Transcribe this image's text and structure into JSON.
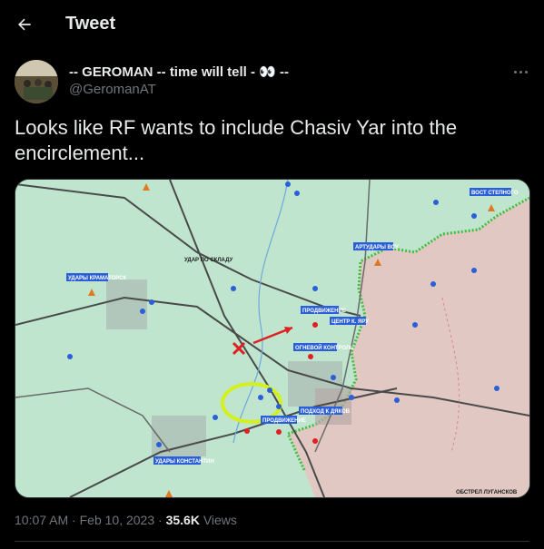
{
  "header": {
    "title": "Tweet"
  },
  "author": {
    "display_name": "-- GEROMAN -- time will tell - 👀 --",
    "handle": "@GeromanAT"
  },
  "tweet": {
    "text": "Looks like RF wants to include Chasiv Yar into the encirclement..."
  },
  "map": {
    "labels": {
      "top_right": "ВОСТ СТЕПНОГО",
      "strike_depot": "УДАР ПО СКЛАДУ",
      "strikes_kramatorsk": "УДАРЫ КРАМАТОРСК",
      "artillery": "АРТУДАРЫ ВСУ",
      "advance_1": "ПРОДВИЖЕНИЕ",
      "center_bakhmut": "ЦЕНТР К. ЯРУ",
      "fire_control": "ОГНЕВОЙ КОНТРОЛЬ",
      "assault_dyakov": "ПОДХОД К ДЯКОВ",
      "advance_2": "ПРОДВИЖЕНИЕ",
      "strikes_konstantinovka": "УДАРЫ КОНСТАНТИН",
      "shelling_luhansk": "ОБСТРЕЛ ЛУГАНСКОВ"
    },
    "colors": {
      "land": "#bfe5cf",
      "occupied": "#e2c8c3",
      "frontline": "#3fbf3f",
      "roads": "#4a4a4a",
      "highlight": "#d4f01e",
      "marker": "#e02020"
    }
  },
  "meta": {
    "time": "10:07 AM",
    "date": "Feb 10, 2023",
    "views_count": "35.6K",
    "views_label": "Views"
  }
}
